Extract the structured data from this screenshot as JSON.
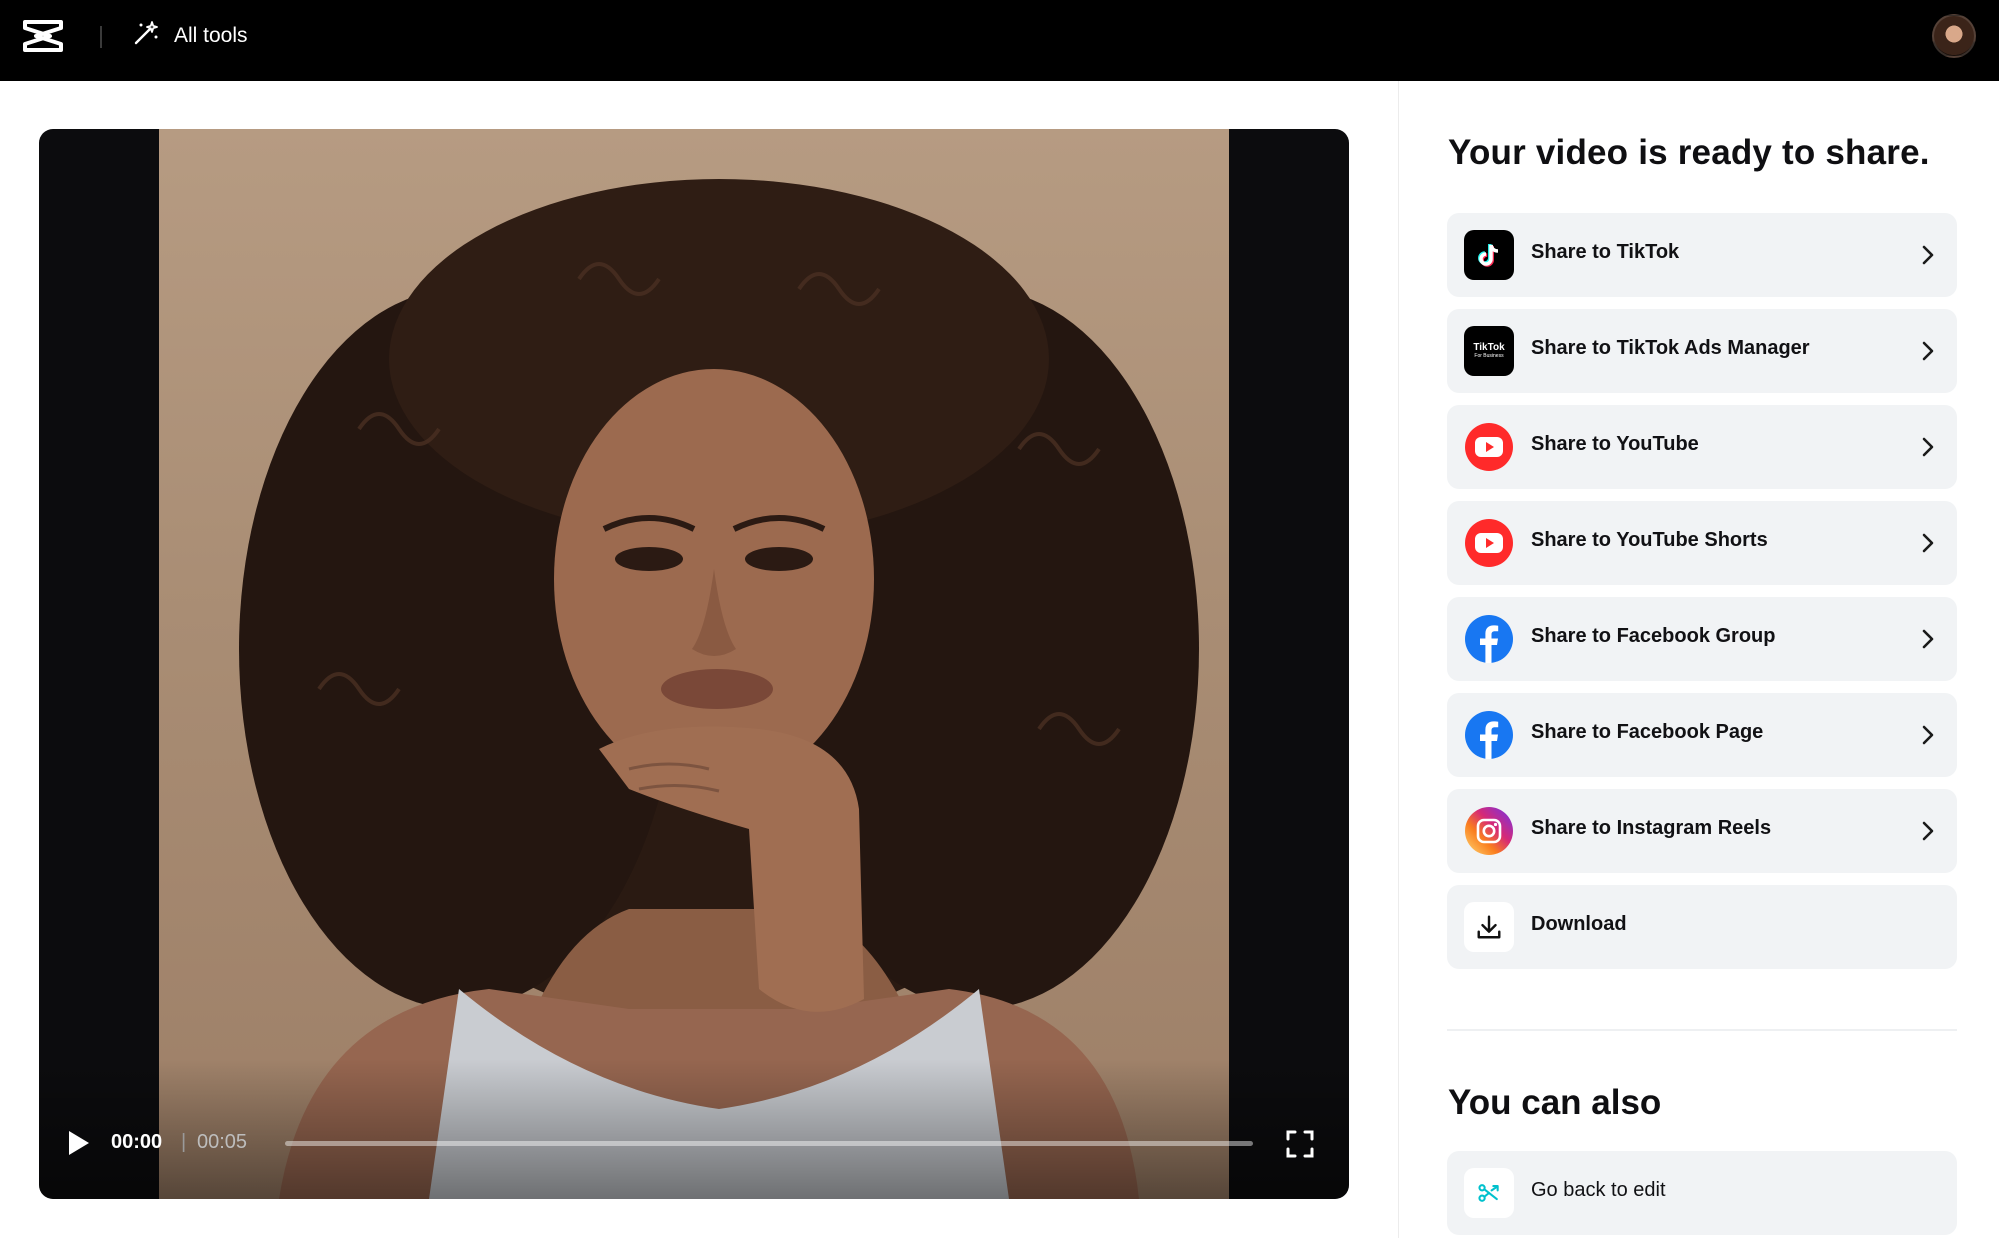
{
  "header": {
    "logo_icon": "capcut-logo-icon",
    "all_tools_label": "All tools",
    "all_tools_icon": "magic-wand-icon",
    "avatar_icon": "user-avatar"
  },
  "player": {
    "current_time": "00:00",
    "separator": "|",
    "total_time": "00:05",
    "progress": 0,
    "play_icon": "play-icon",
    "fullscreen_icon": "fullscreen-icon"
  },
  "share": {
    "title": "Your video is ready to share.",
    "items": [
      {
        "label": "Share to TikTok",
        "icon": "tiktok-icon"
      },
      {
        "label": "Share to TikTok Ads Manager",
        "icon": "tiktok-business-icon"
      },
      {
        "label": "Share to YouTube",
        "icon": "youtube-icon"
      },
      {
        "label": "Share to YouTube Shorts",
        "icon": "youtube-icon"
      },
      {
        "label": "Share to Facebook Group",
        "icon": "facebook-icon"
      },
      {
        "label": "Share to Facebook Page",
        "icon": "facebook-icon"
      },
      {
        "label": "Share to Instagram Reels",
        "icon": "instagram-icon"
      },
      {
        "label": "Download",
        "icon": "download-icon"
      }
    ],
    "tiktok_business_text": "TikTok",
    "tiktok_business_subtext": "For Business"
  },
  "also": {
    "title": "You can also",
    "go_back_label": "Go back to edit",
    "go_back_icon": "edit-branch-icon"
  },
  "colors": {
    "topbar": "#000000",
    "card_bg": "#f1f3f5",
    "youtube_red": "#ff0000",
    "facebook_blue": "#1877f2",
    "accent_cyan": "#00c1cd"
  }
}
